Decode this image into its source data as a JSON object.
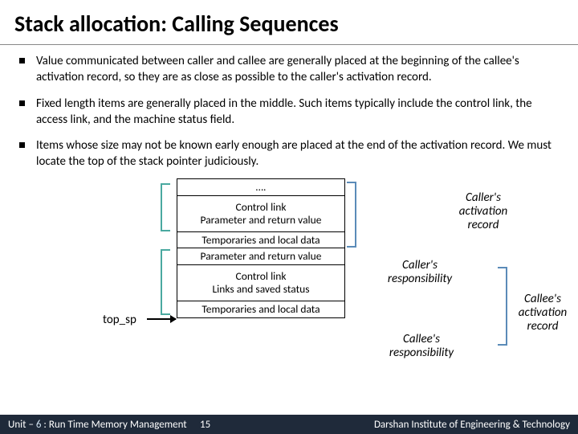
{
  "title": "Stack allocation: Calling Sequences",
  "bullets": [
    "Value communicated between caller and callee are generally placed at the beginning of the callee's activation record, so they are as close as possible to the caller's activation record.",
    "Fixed length items are generally placed in the middle. Such items typically include the control link, the access link, and the machine status field.",
    "Items whose size may not be known early enough are placed at the end of the activation record. We must locate the top of the stack pointer judiciously."
  ],
  "stack": {
    "r0": "….",
    "r1a": "Control link",
    "r1b": "Parameter and return value",
    "r2": "Temporaries and local data",
    "r3": "Parameter and return value",
    "r4a": "Control link",
    "r4b": "Links and saved status",
    "r5": "Temporaries and local data"
  },
  "pointer": "top_sp",
  "labels": {
    "callerAR": "Caller's activation record",
    "callerResp": "Caller's responsibility",
    "calleeAR": "Callee's activation record",
    "calleeResp": "Callee's responsibility"
  },
  "footer": {
    "unit_prefix": "Unit – ",
    "unit_num": "6",
    "unit_suffix": " : Run Time Memory Management",
    "page": "15",
    "institute": "Darshan Institute of Engineering & Technology"
  }
}
